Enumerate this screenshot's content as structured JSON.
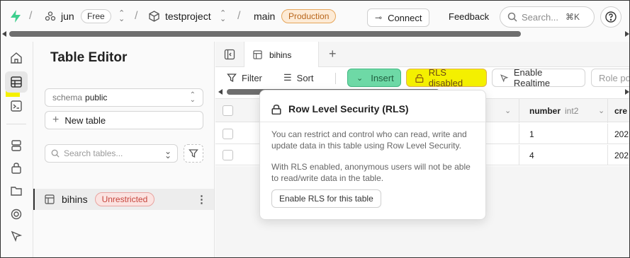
{
  "topbar": {
    "org_name": "jun",
    "plan_badge": "Free",
    "project_name": "testproject",
    "branch_name": "main",
    "env_badge": "Production",
    "connect_label": "Connect",
    "feedback_label": "Feedback",
    "search_placeholder": "Search...",
    "search_shortcut": "⌘K",
    "separator": "/"
  },
  "panel": {
    "title": "Table Editor",
    "schema_prefix": "schema",
    "schema_value": "public",
    "new_table_label": "New table",
    "search_placeholder": "Search tables...",
    "tables": [
      {
        "name": "bihins",
        "badge": "Unrestricted"
      }
    ]
  },
  "tabs": [
    {
      "label": "bihins"
    }
  ],
  "toolbar": {
    "filter_label": "Filter",
    "sort_label": "Sort",
    "insert_label": "Insert",
    "rls_label": "RLS disabled",
    "realtime_label": "Enable Realtime",
    "role_label": "Role po"
  },
  "grid": {
    "columns": [
      {
        "name": "number",
        "type": "int2"
      },
      {
        "name": "cre",
        "type": ""
      }
    ],
    "rows": [
      {
        "number": "1",
        "created": "202"
      },
      {
        "number": "4",
        "created": "202"
      }
    ]
  },
  "popover": {
    "title": "Row Level Security (RLS)",
    "paragraph1": "You can restrict and control who can read, write and update data in this table using Row Level Security.",
    "paragraph2": "With RLS enabled, anonymous users will not be able to read/write data in the table.",
    "button_label": "Enable RLS for this table"
  },
  "colors": {
    "brand_green": "#3ecf8e",
    "highlight_yellow": "#f5f000",
    "production_orange": "#b8651a",
    "unrestricted_red": "#c6453d"
  }
}
